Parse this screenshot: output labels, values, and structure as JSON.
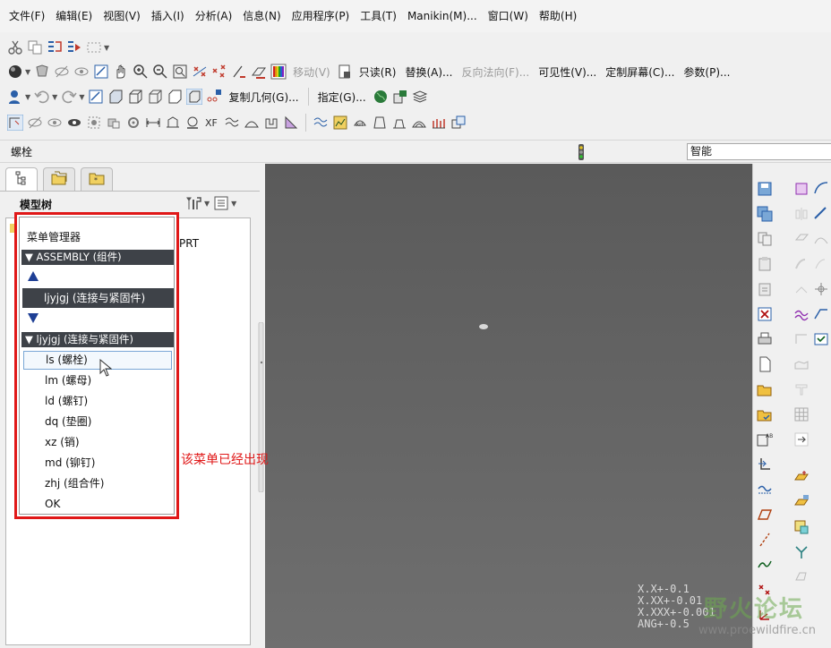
{
  "menubar": {
    "items": [
      "文件(F)",
      "编辑(E)",
      "视图(V)",
      "插入(I)",
      "分析(A)",
      "信息(N)",
      "应用程序(P)",
      "工具(T)",
      "Manikin(M)...",
      "窗口(W)",
      "帮助(H)"
    ]
  },
  "toolbar": {
    "move": "移动(V)",
    "readonly": "只读(R)",
    "replace": "替换(A)...",
    "reverse_normal": "反向法向(F)...",
    "visibility": "可见性(V)...",
    "custom_screen": "定制屏幕(C)...",
    "params": "参数(P)...",
    "copy_geom": "复制几何(G)...",
    "assign": "指定(G)..."
  },
  "status": {
    "text": "螺栓",
    "filter": "智能"
  },
  "model_tree": {
    "title": "模型树",
    "root_label": "PRT"
  },
  "menu_manager": {
    "title": "菜单管理器",
    "section1": "ASSEMBLY (组件)",
    "selected": "ljyjgj (连接与紧固件)",
    "section2": "ljyjgj (连接与紧固件)",
    "items": [
      "ls (螺栓)",
      "lm (螺母)",
      "ld (螺钉)",
      "dq (垫圈)",
      "xz (销)",
      "md (铆钉)",
      "zhj (组合件)",
      "OK"
    ]
  },
  "annotation": {
    "note": "该菜单已经出现"
  },
  "watermark": {
    "coords": [
      "X.X+-0.1",
      "X.XX+-0.01",
      "X.XXX+-0.001",
      "ANG+-0.5"
    ],
    "logo": "野火论坛",
    "url": "www.proewildfire.cn"
  },
  "colors": {
    "highlight_border": "#e01818",
    "menu_header_bg": "#3e4248",
    "viewport_bg": "#666666"
  }
}
